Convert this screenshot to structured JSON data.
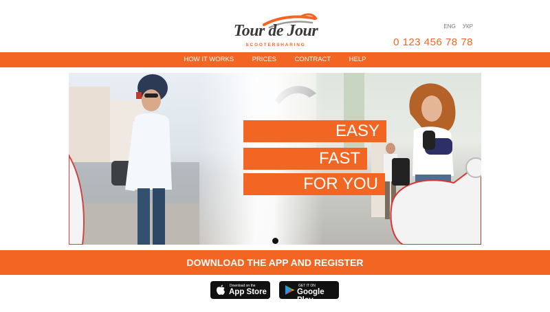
{
  "brand": {
    "name": "Tour de Jour",
    "tagline": "SCOOTERSHARING",
    "accent": "#f26522"
  },
  "header": {
    "languages": [
      "ENG",
      "УКР"
    ],
    "phone": "0 123 456 78 78"
  },
  "nav": {
    "items": [
      "HOW IT WORKS",
      "PRICES",
      "CONTRACT",
      "HELP"
    ]
  },
  "hero": {
    "slogans": [
      "EASY",
      "FAST",
      "FOR YOU"
    ],
    "carousel": {
      "slides": 1,
      "active": 1
    }
  },
  "banner": {
    "text": "DOWNLOAD THE APP AND REGISTER"
  },
  "stores": {
    "apple": {
      "small": "Download on the",
      "big": "App Store",
      "icon": "apple-icon"
    },
    "google": {
      "small": "GET IT ON",
      "big": "Google Play",
      "icon": "google-play-icon"
    }
  }
}
